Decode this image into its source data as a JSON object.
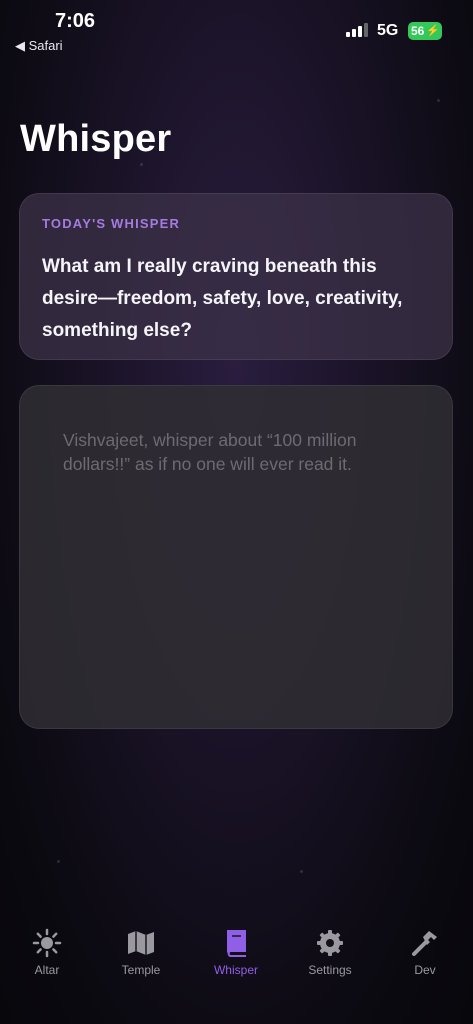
{
  "status_bar": {
    "time": "7:06",
    "back_label": "◀ Safari",
    "network": "5G",
    "battery": "56",
    "battery_color": "#34c759"
  },
  "page": {
    "title": "Whisper"
  },
  "prompt_card": {
    "kicker": "TODAY'S WHISPER",
    "text": "What am I really craving beneath this desire—freedom, safety, love, creativity, something else?"
  },
  "entry": {
    "placeholder": "Vishvajeet, whisper about “100 million dollars!!” as if no one will ever read it."
  },
  "tabs": [
    {
      "label": "Altar",
      "icon": "sun-icon"
    },
    {
      "label": "Temple",
      "icon": "map-icon"
    },
    {
      "label": "Whisper",
      "icon": "book-icon",
      "active": true
    },
    {
      "label": "Settings",
      "icon": "gear-icon"
    },
    {
      "label": "Dev",
      "icon": "hammer-icon"
    }
  ],
  "colors": {
    "accent": "#8f5fe6",
    "kicker": "#a57be0",
    "inactive_tab": "#9a99a0"
  }
}
